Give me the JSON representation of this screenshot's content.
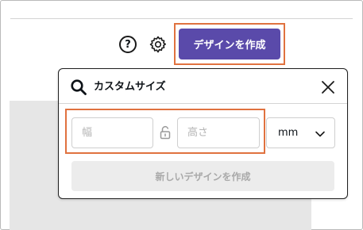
{
  "toolbar": {
    "help_icon_glyph": "?",
    "create_design_label": "デザインを作成"
  },
  "custom_size_popup": {
    "title": "カスタムサイズ",
    "width_placeholder": "幅",
    "height_placeholder": "高さ",
    "unit_selected": "mm",
    "create_new_label": "新しいデザインを作成"
  },
  "icons": {
    "help": "help-circle-icon",
    "settings": "gear-icon",
    "search": "search-icon",
    "close": "close-icon",
    "lock": "unlocked-padlock-icon",
    "dropdown": "chevron-down-icon"
  },
  "colors": {
    "create_button": "#5a4aaa",
    "highlight_outline": "#e0723f",
    "disabled_button_bg": "#ececec",
    "disabled_button_text": "#a9a9a9"
  }
}
